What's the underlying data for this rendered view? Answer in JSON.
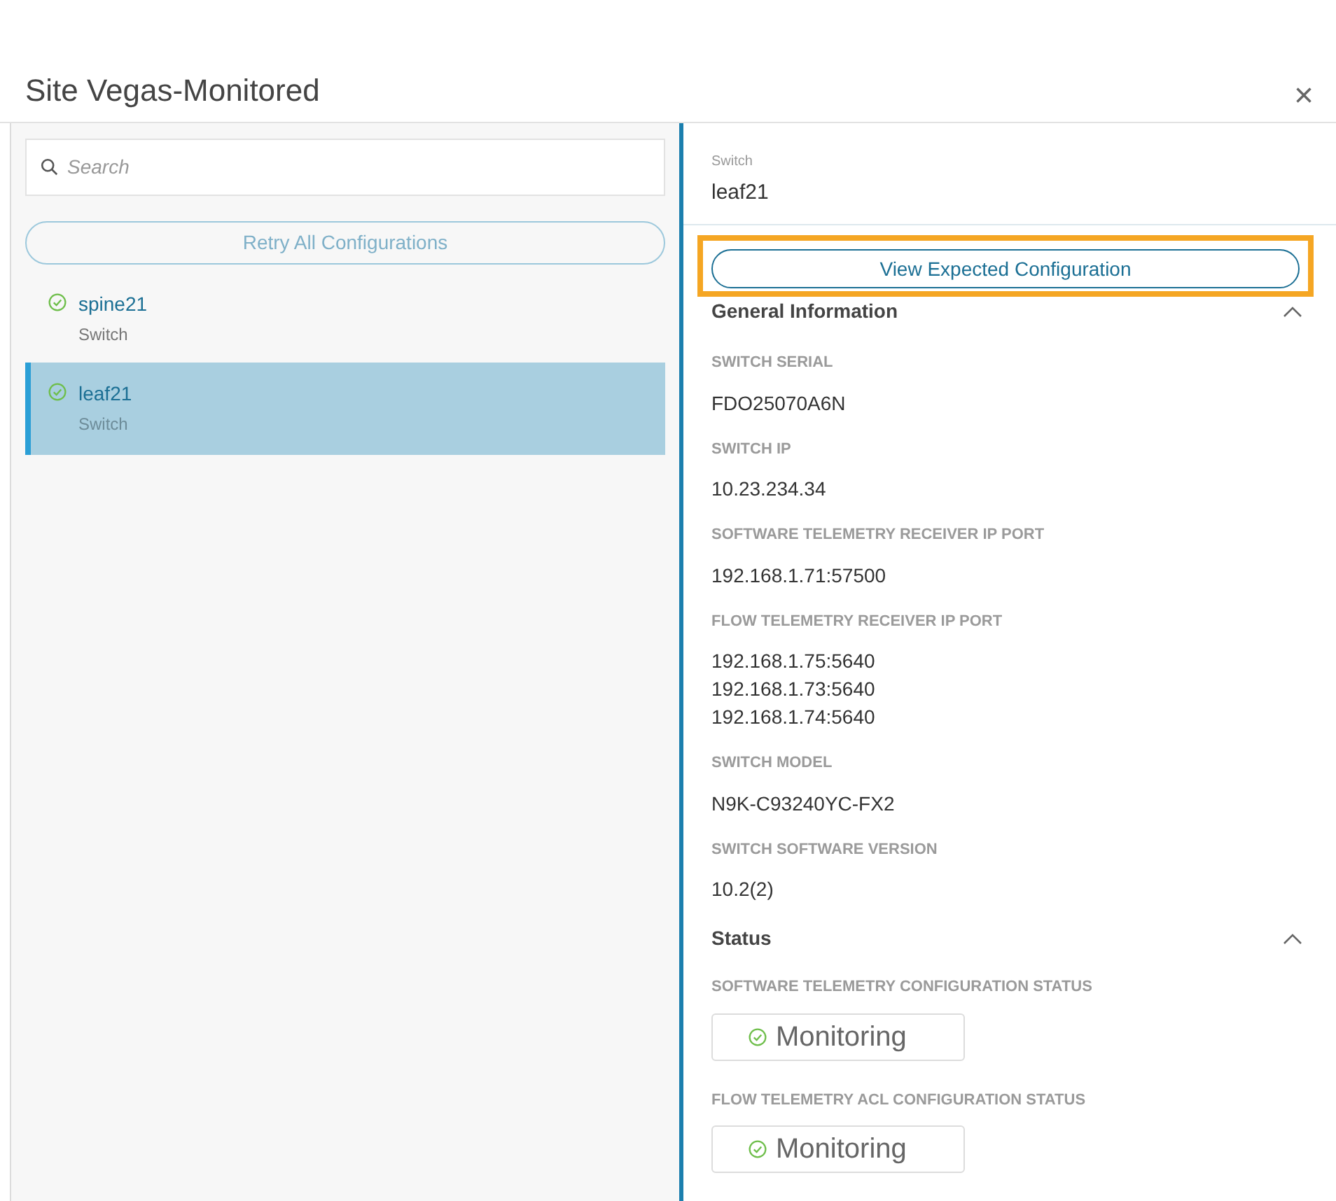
{
  "window": {
    "title": "Site Vegas-Monitored",
    "close": "×"
  },
  "search": {
    "placeholder": "Search"
  },
  "retry_button": "Retry All Configurations",
  "items": [
    {
      "name": "spine21",
      "type": "Switch",
      "selected": false
    },
    {
      "name": "leaf21",
      "type": "Switch",
      "selected": true
    }
  ],
  "detail": {
    "type_label": "Switch",
    "name": "leaf21",
    "action": {
      "label": "View Expected Configuration",
      "highlighted": true
    },
    "sections": [
      {
        "title": "General Information",
        "expanded": true,
        "fields": [
          {
            "kind": "text",
            "label": "SWITCH SERIAL",
            "values": [
              "FDO25070A6N"
            ]
          },
          {
            "kind": "text",
            "label": "SWITCH IP",
            "values": [
              "10.23.234.34"
            ]
          },
          {
            "kind": "text",
            "label": "SOFTWARE TELEMETRY RECEIVER IP PORT",
            "values": [
              "192.168.1.71:57500"
            ]
          },
          {
            "kind": "text",
            "label": "FLOW TELEMETRY RECEIVER IP PORT",
            "values": [
              "192.168.1.75:5640",
              "192.168.1.73:5640",
              "192.168.1.74:5640"
            ]
          },
          {
            "kind": "text",
            "label": "SWITCH MODEL",
            "values": [
              "N9K-C93240YC-FX2"
            ]
          },
          {
            "kind": "text",
            "label": "SWITCH SOFTWARE VERSION",
            "values": [
              "10.2(2)"
            ]
          }
        ]
      },
      {
        "title": "Status",
        "expanded": true,
        "fields": [
          {
            "kind": "status",
            "label": "SOFTWARE TELEMETRY CONFIGURATION STATUS",
            "values": [
              "Monitoring"
            ]
          },
          {
            "kind": "status",
            "label": "FLOW TELEMETRY ACL CONFIGURATION STATUS",
            "values": [
              "Monitoring"
            ]
          }
        ]
      }
    ]
  }
}
